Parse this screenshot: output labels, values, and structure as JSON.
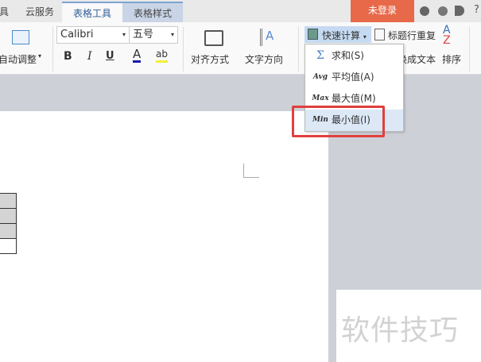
{
  "tabs": [
    {
      "label": "具"
    },
    {
      "label": "云服务"
    },
    {
      "label": "表格工具"
    },
    {
      "label": "表格样式"
    }
  ],
  "login_button": "未登录",
  "ribbon": {
    "auto_adjust": "自动调整",
    "font_name": "Calibri",
    "font_size": "五号",
    "bold": "B",
    "italic": "I",
    "underline": "U",
    "font_color": "A",
    "highlight": "ab",
    "align": "对齐方式",
    "text_direction": "文字方向",
    "quick_calc": "快速计算",
    "repeat_header": "标题行重复",
    "convert_text": "换成文本",
    "sort": "排序"
  },
  "menu": [
    {
      "icon": "Σ",
      "label": "求和(S)"
    },
    {
      "icon": "Avg",
      "label": "平均值(A)"
    },
    {
      "icon": "Max",
      "label": "最大值(M)"
    },
    {
      "icon": "Min",
      "label": "最小值(I)"
    }
  ],
  "watermark": "软件技巧"
}
